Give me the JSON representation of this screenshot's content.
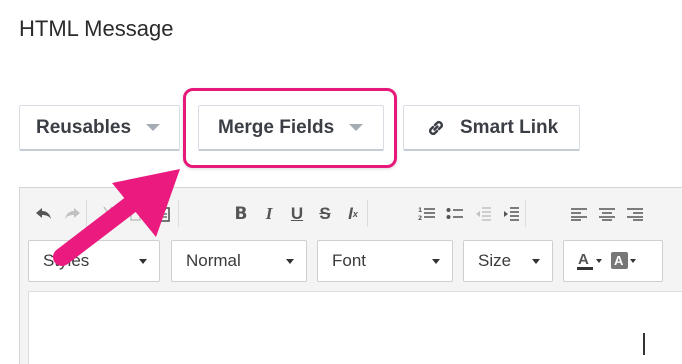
{
  "section_title": "HTML Message",
  "buttons": {
    "reusables": "Reusables",
    "merge_fields": "Merge Fields",
    "smart_link": "Smart Link"
  },
  "editor": {
    "combos": {
      "styles": "Styles",
      "format": "Normal",
      "font": "Font",
      "size": "Size"
    }
  },
  "colors": {
    "highlight": "#e6197a",
    "arrow": "#ea1a7f"
  }
}
